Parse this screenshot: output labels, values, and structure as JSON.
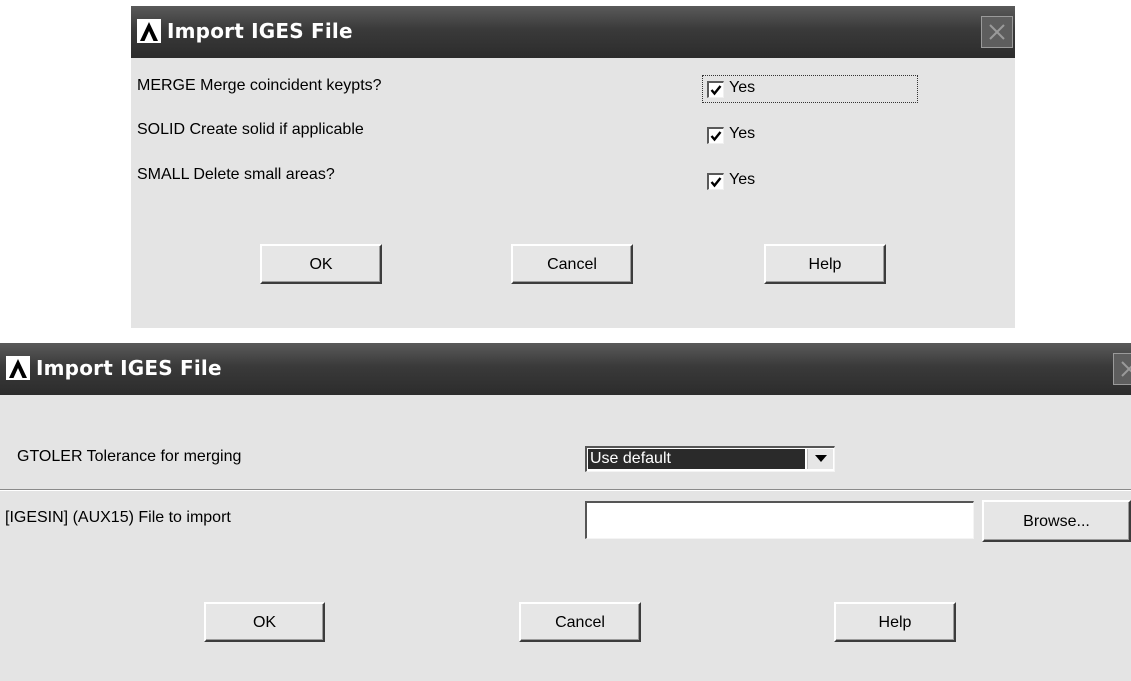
{
  "dialog_merge": {
    "title": "Import IGES File",
    "rows": [
      {
        "label": "MERGE Merge coincident keypts?",
        "checked": true,
        "option_label": "Yes"
      },
      {
        "label": "SOLID Create solid if applicable",
        "checked": true,
        "option_label": "Yes"
      },
      {
        "label": "SMALL Delete small areas?",
        "checked": true,
        "option_label": "Yes"
      }
    ],
    "buttons": {
      "ok": "OK",
      "cancel": "Cancel",
      "help": "Help"
    }
  },
  "dialog_file": {
    "title": "Import IGES File",
    "gtoler": {
      "label": "GTOLER  Tolerance for merging",
      "selected": "Use default"
    },
    "file": {
      "label": "[IGESIN] (AUX15)  File to import",
      "value": "",
      "browse_label": "Browse..."
    },
    "buttons": {
      "ok": "OK",
      "cancel": "Cancel",
      "help": "Help"
    }
  },
  "icons": [
    "ansys-logo-icon",
    "close-icon",
    "checkmark-icon",
    "dropdown-arrow-icon"
  ]
}
